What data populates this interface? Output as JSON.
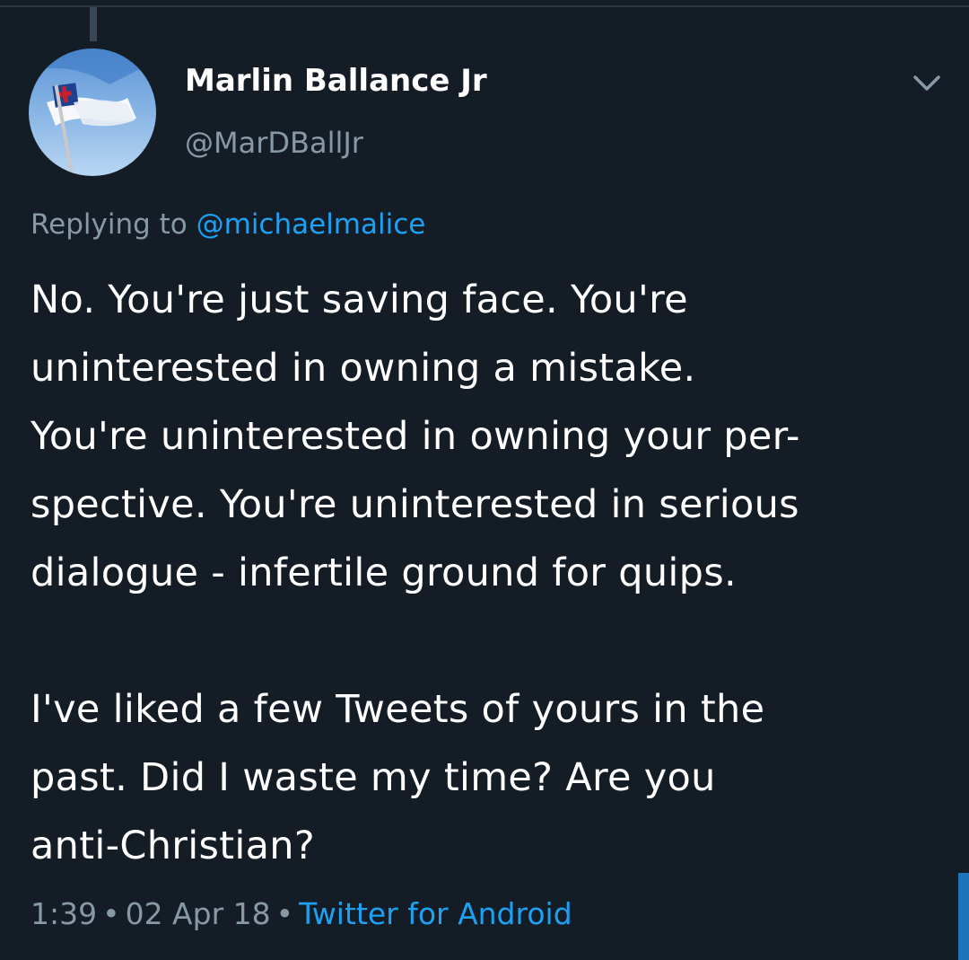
{
  "tweet": {
    "author": {
      "display_name": "Marlin Ballance Jr",
      "handle": "@MarDBallJr",
      "avatar_icon": "christian-flag-avatar"
    },
    "reply": {
      "prefix": "Replying to ",
      "mention": "@michaelmalice"
    },
    "text": "No. You're just saving face. You're\nuninterested in owning a mistake.\nYou're uninterested in owning your per-\nspective. You're uninterested in serious\ndialogue - infertile ground for quips.\n\nI've liked a few Tweets of yours in the\npast. Did I waste my time? Are you\nanti-Christian?",
    "meta": {
      "time": "1:39",
      "separator": "•",
      "date": "02 Apr 18",
      "source": "Twitter for Android"
    },
    "menu_icon": "chevron-down-icon"
  },
  "colors": {
    "background": "#141c26",
    "text": "#ffffff",
    "secondary_text": "#8899a6",
    "accent": "#1da1f2"
  }
}
